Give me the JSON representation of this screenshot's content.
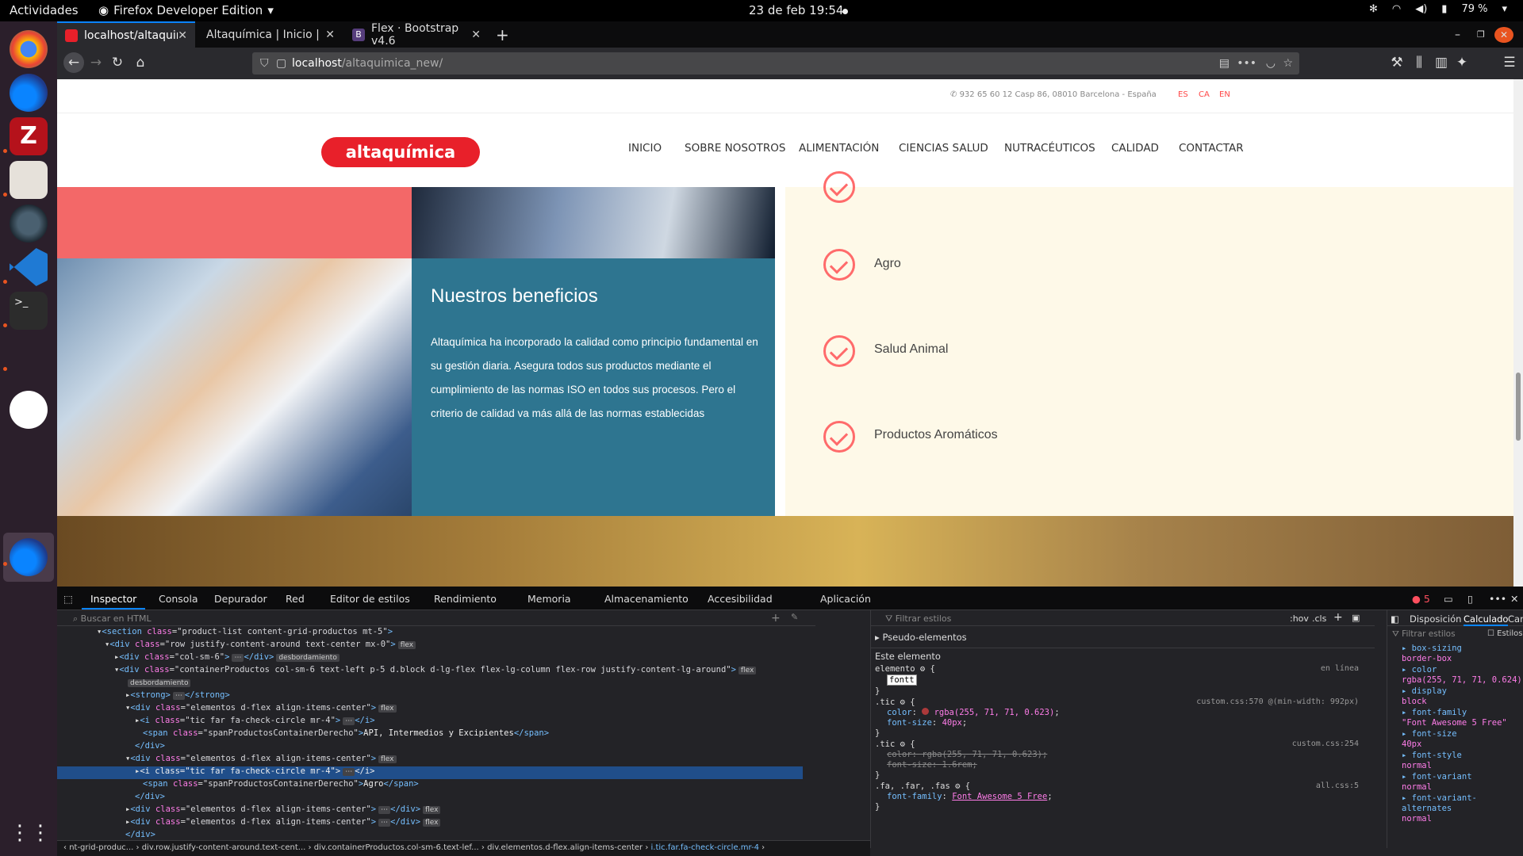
{
  "topbar": {
    "activities": "Actividades",
    "app": "Firefox Developer Edition",
    "clock": "23 de feb  19:54",
    "battery": "79 %"
  },
  "tabs": [
    {
      "label": "localhost/altaquimica_n",
      "favicon_color": "#e8202a"
    },
    {
      "label": "Altaquímica | Inicio | Distribu",
      "favicon_color": "#444"
    },
    {
      "label": "Flex · Bootstrap v4.6",
      "favicon_color": "#563d7c"
    }
  ],
  "url": {
    "host": "localhost",
    "path": "/altaquimica_new/"
  },
  "site": {
    "contact": "932 65 60 12 Casp 86, 08010 Barcelona - España",
    "langs": [
      "ES",
      "CA",
      "EN"
    ],
    "logo": "altaquímica",
    "nav": [
      "INICIO",
      "SOBRE NOSOTROS",
      "ALIMENTACIÓN",
      "CIENCIAS SALUD",
      "NUTRACÉUTICOS",
      "CALIDAD",
      "CONTACTAR"
    ],
    "benefits_title": "Nuestros beneficios",
    "benefits_text": "Altaquímica ha incorporado la calidad como principio fundamental en su gestión diaria. Asegura todos sus productos mediante el cumplimiento de las normas ISO en todos sus procesos. Pero el criterio de calidad va más allá de las normas establecidas",
    "items": [
      "Agro",
      "Salud Animal",
      "Productos Aromáticos"
    ],
    "accent": "#ff6b6b",
    "teal": "#2e7590"
  },
  "devtools": {
    "tabs": [
      "Inspector",
      "Consola",
      "Depurador",
      "Red",
      "Editor de estilos",
      "Rendimiento",
      "Memoria",
      "Almacenamiento",
      "Accesibilidad",
      "Aplicación"
    ],
    "error_count": "5",
    "html_search": "Buscar en HTML",
    "styles_filter": "Filtrar estilos",
    "hov": ":hov",
    "cls": ".cls",
    "pseudo": "Pseudo-elementos",
    "this_element": "Este elemento",
    "right_tabs": [
      "Disposición",
      "Calculado",
      "Cambi"
    ],
    "computed_filter": "Filtrar estilos",
    "browser_styles": "Estilos de n...",
    "computed": [
      {
        "name": "box-sizing",
        "value": "border-box"
      },
      {
        "name": "color",
        "value": "rgba(255, 71, 71, 0.624)"
      },
      {
        "name": "display",
        "value": "block"
      },
      {
        "name": "font-family",
        "value": "\"Font Awesome 5 Free\""
      },
      {
        "name": "font-size",
        "value": "40px"
      },
      {
        "name": "font-style",
        "value": "normal"
      },
      {
        "name": "font-variant",
        "value": "normal"
      },
      {
        "name": "font-variant-alternates",
        "value": "normal"
      }
    ],
    "breadcrumbs": [
      "nt-grid-produc...",
      "div.row.justify-content-around.text-cent...",
      "div.containerProductos.col-sm-6.text-lef...",
      "div.elementos.d-flex.align-items-center",
      "i.tic.far.fa-check-circle.mr-4"
    ]
  }
}
